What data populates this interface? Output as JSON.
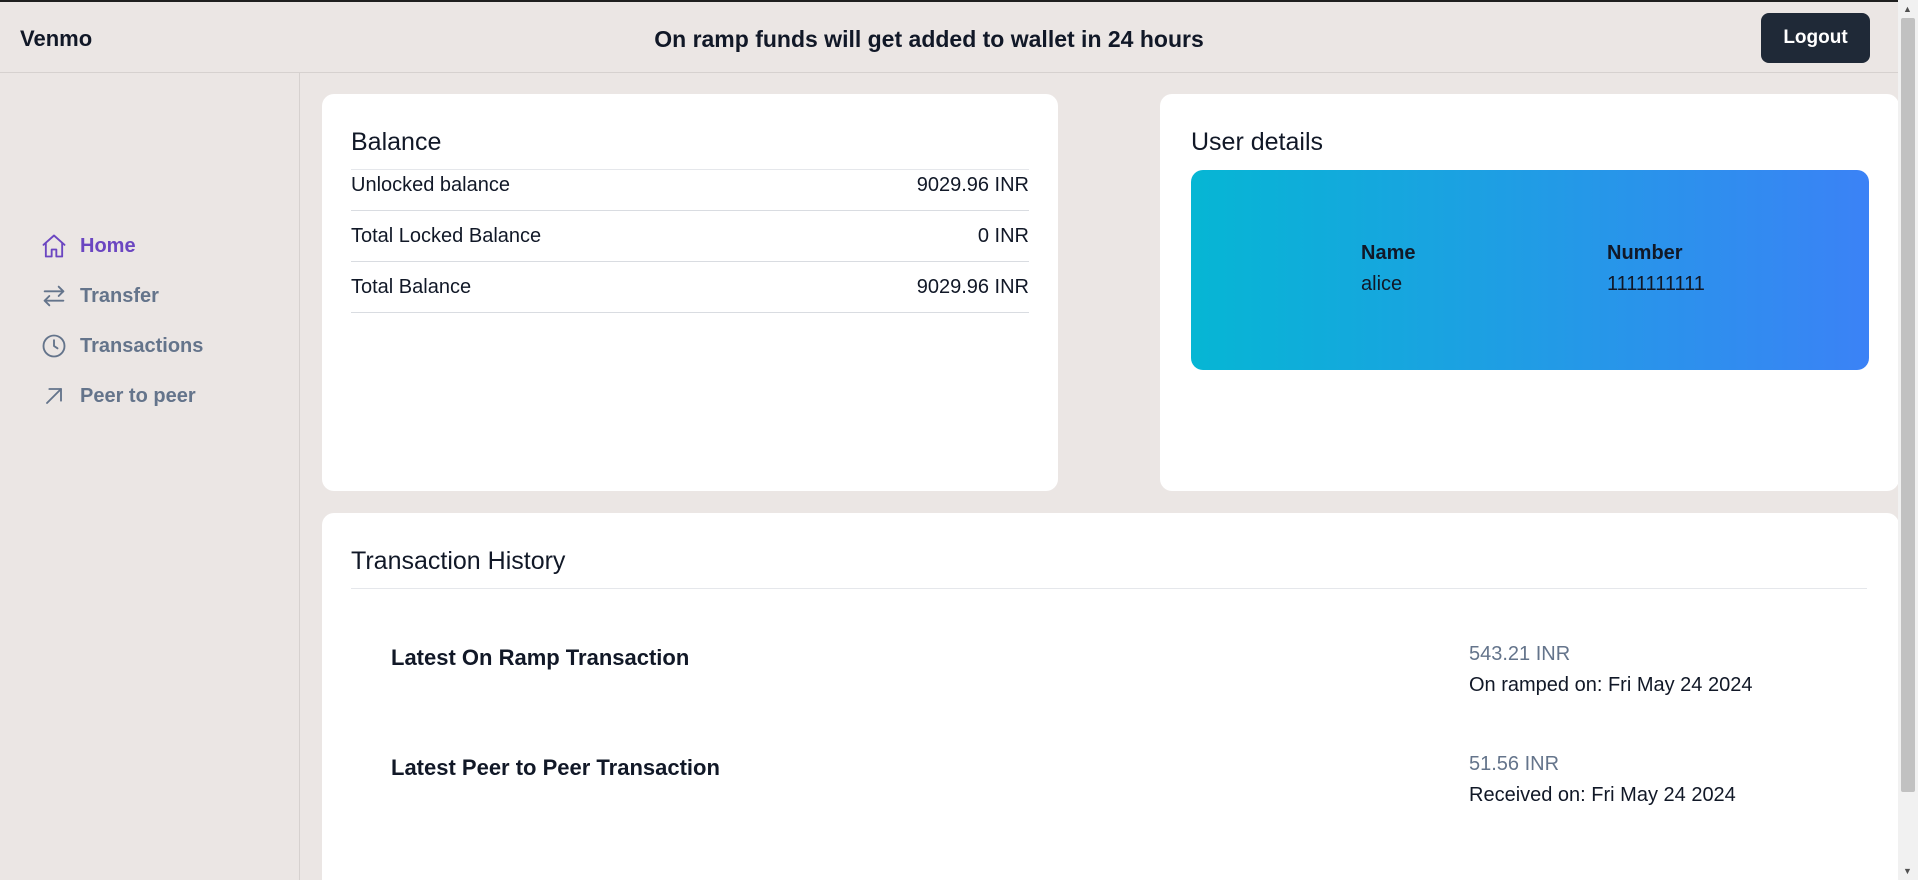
{
  "header": {
    "brand": "Venmo",
    "announcement": "On ramp funds will get added to wallet in 24 hours",
    "logout_label": "Logout"
  },
  "sidebar": {
    "items": [
      {
        "label": "Home",
        "icon": "home-icon",
        "active": true
      },
      {
        "label": "Transfer",
        "icon": "transfer-icon",
        "active": false
      },
      {
        "label": "Transactions",
        "icon": "clock-icon",
        "active": false
      },
      {
        "label": "Peer to peer",
        "icon": "arrow-up-right-icon",
        "active": false
      }
    ]
  },
  "balance": {
    "title": "Balance",
    "rows": [
      {
        "label": "Unlocked balance",
        "value": "9029.96 INR"
      },
      {
        "label": "Total Locked Balance",
        "value": "0 INR"
      },
      {
        "label": "Total Balance",
        "value": "9029.96 INR"
      }
    ]
  },
  "user_details": {
    "title": "User details",
    "name_header": "Name",
    "name_value": "alice",
    "number_header": "Number",
    "number_value": "1111111111"
  },
  "history": {
    "title": "Transaction History",
    "items": [
      {
        "label": "Latest On Ramp Transaction",
        "amount": "543.21 INR",
        "date": "On ramped on: Fri May 24 2024"
      },
      {
        "label": "Latest Peer to Peer Transaction",
        "amount": "51.56 INR",
        "date": "Received on: Fri May 24 2024"
      }
    ]
  },
  "colors": {
    "accent": "#6b46c1",
    "muted": "#64748b",
    "gradient_start": "#06b6d4",
    "gradient_end": "#3b82f6",
    "button_bg": "#1f2937"
  }
}
